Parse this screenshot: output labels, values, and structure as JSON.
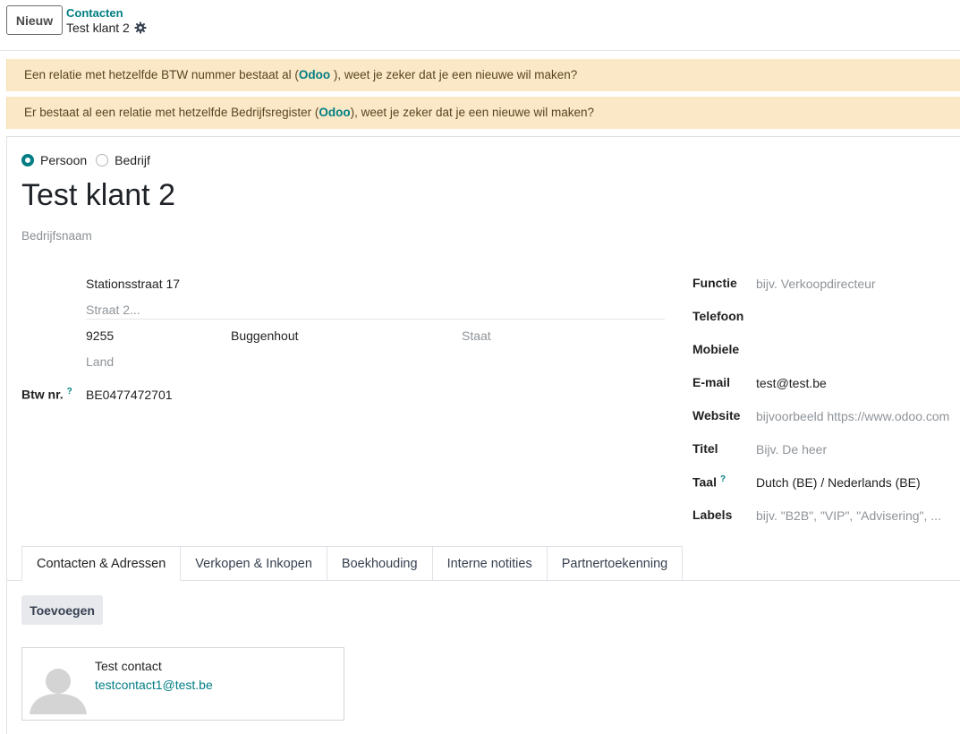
{
  "header": {
    "new_button": "Nieuw",
    "breadcrumb_parent": "Contacten",
    "breadcrumb_current": "Test klant 2"
  },
  "alerts": [
    {
      "before": "Een relatie met hetzelfde BTW nummer bestaat al (",
      "link": "Odoo",
      "after": " ), weet je zeker dat je een nieuwe wil maken?"
    },
    {
      "before": "Er bestaat al een relatie met hetzelfde Bedrijfsregister (",
      "link": "Odoo",
      "after": "), weet je zeker dat je een nieuwe wil maken?"
    }
  ],
  "type_options": {
    "person": "Persoon",
    "company": "Bedrijf",
    "selected": "Persoon"
  },
  "partner": {
    "name": "Test klant 2",
    "company_placeholder": "Bedrijfsnaam"
  },
  "address": {
    "street": "Stationsstraat 17",
    "street2_placeholder": "Straat 2...",
    "zip": "9255",
    "city": "Buggenhout",
    "state_placeholder": "Staat",
    "country_placeholder": "Land"
  },
  "vat": {
    "label": "Btw nr.",
    "help": "?",
    "value": "BE0477472701"
  },
  "right_fields": {
    "function": {
      "label": "Functie",
      "placeholder": "bijv. Verkoopdirecteur"
    },
    "phone": {
      "label": "Telefoon"
    },
    "mobile": {
      "label": "Mobiele"
    },
    "email": {
      "label": "E-mail",
      "value": "test@test.be"
    },
    "website": {
      "label": "Website",
      "placeholder": "bijvoorbeeld https://www.odoo.com"
    },
    "title": {
      "label": "Titel",
      "placeholder": "Bijv. De heer"
    },
    "lang": {
      "label": "Taal",
      "help": "?",
      "value": "Dutch (BE) / Nederlands (BE)"
    },
    "tags": {
      "label": "Labels",
      "placeholder": "bijv. \"B2B\", \"VIP\", \"Advisering\", ..."
    }
  },
  "tabs": [
    "Contacten & Adressen",
    "Verkopen & Inkopen",
    "Boekhouding",
    "Interne notities",
    "Partnertoekenning"
  ],
  "contacts": {
    "add_button": "Toevoegen",
    "items": [
      {
        "name": "Test contact",
        "email": "testcontact1@test.be"
      }
    ]
  },
  "colors": {
    "accent": "#017e84",
    "alert_bg": "#fbe8c6"
  },
  "icons": {
    "settings": "gear-icon",
    "avatar": "avatar-placeholder-icon"
  }
}
